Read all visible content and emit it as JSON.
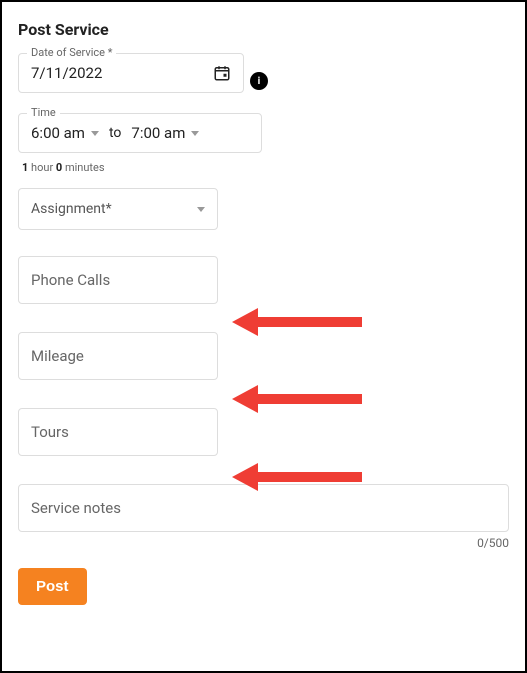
{
  "form": {
    "title": "Post Service",
    "date_label": "Date of Service *",
    "date_value": "7/11/2022",
    "time_label": "Time",
    "time_start": "6:00 am",
    "time_to": "to",
    "time_end": "7:00 am",
    "duration_hours": "1",
    "duration_hours_txt": "hour",
    "duration_mins": "0",
    "duration_mins_txt": "minutes",
    "assignment_label": "Assignment*",
    "phone_calls_label": "Phone Calls",
    "mileage_label": "Mileage",
    "tours_label": "Tours",
    "notes_placeholder": "Service notes",
    "counter": "0/500",
    "post_label": "Post",
    "info_char": "i"
  }
}
